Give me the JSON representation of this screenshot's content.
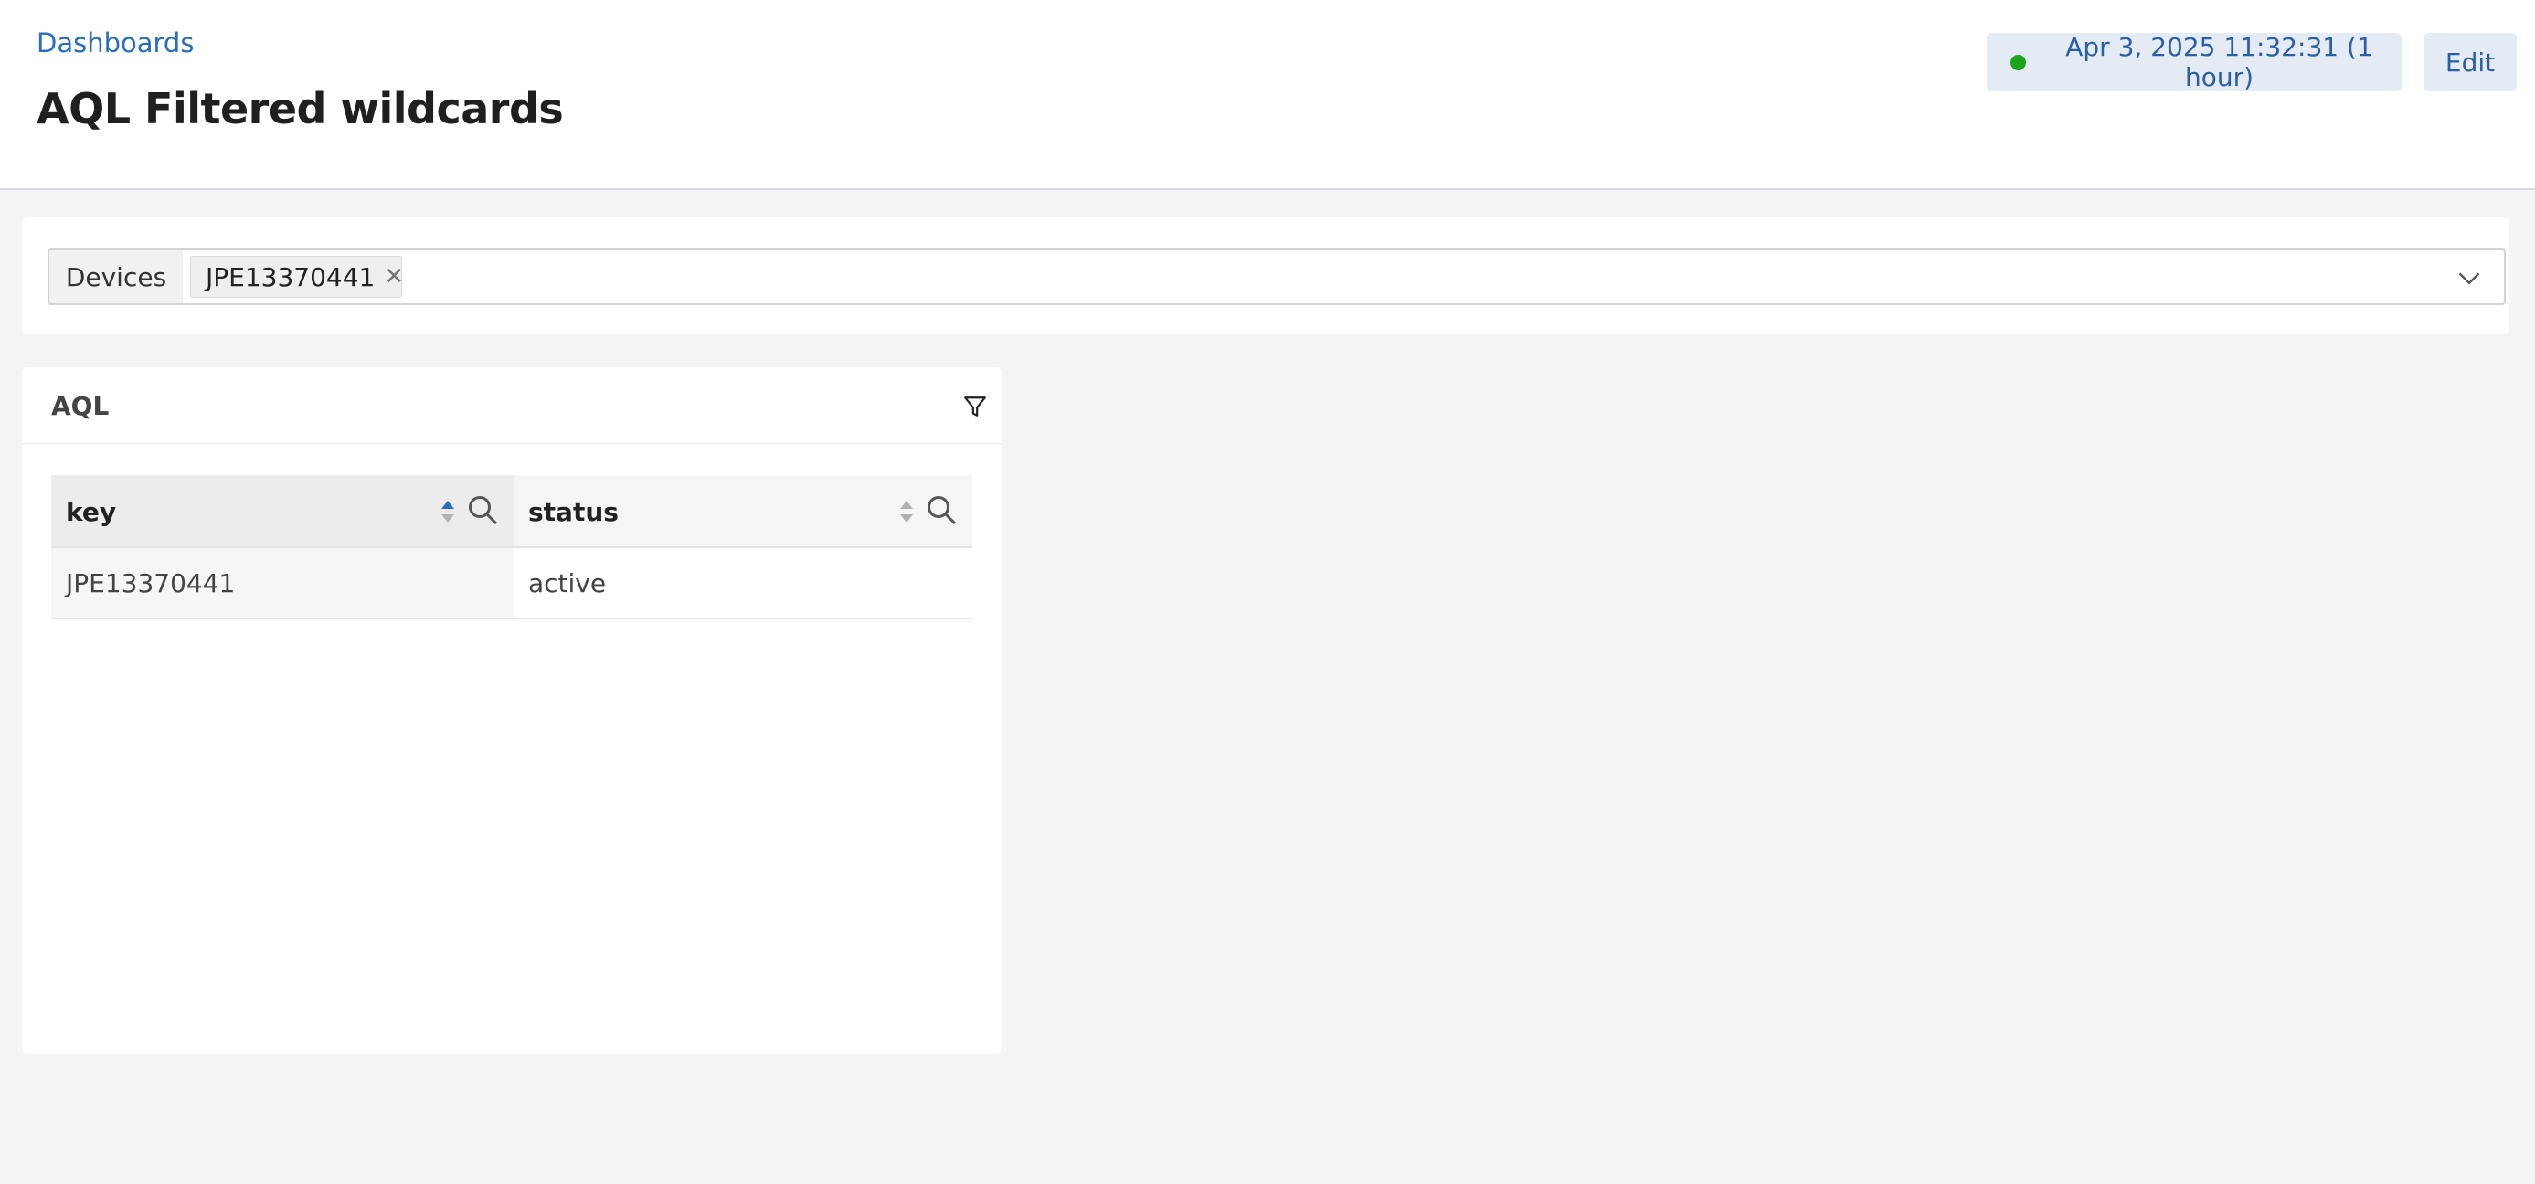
{
  "header": {
    "breadcrumb": "Dashboards",
    "title": "AQL Filtered wildcards",
    "time_range": "Apr 3, 2025 11:32:31 (1 hour)",
    "edit_label": "Edit"
  },
  "filter": {
    "label": "Devices",
    "selected": [
      "JPE13370441"
    ]
  },
  "card": {
    "title": "AQL",
    "table": {
      "columns": [
        {
          "label": "key",
          "sort": "ascending"
        },
        {
          "label": "status",
          "sort": "none"
        }
      ],
      "rows": [
        {
          "key": "JPE13370441",
          "status": "active"
        }
      ]
    }
  },
  "colors": {
    "accent": "#2a6ebb",
    "status_live": "#1aa51a",
    "button_bg": "#e4ebf5"
  }
}
